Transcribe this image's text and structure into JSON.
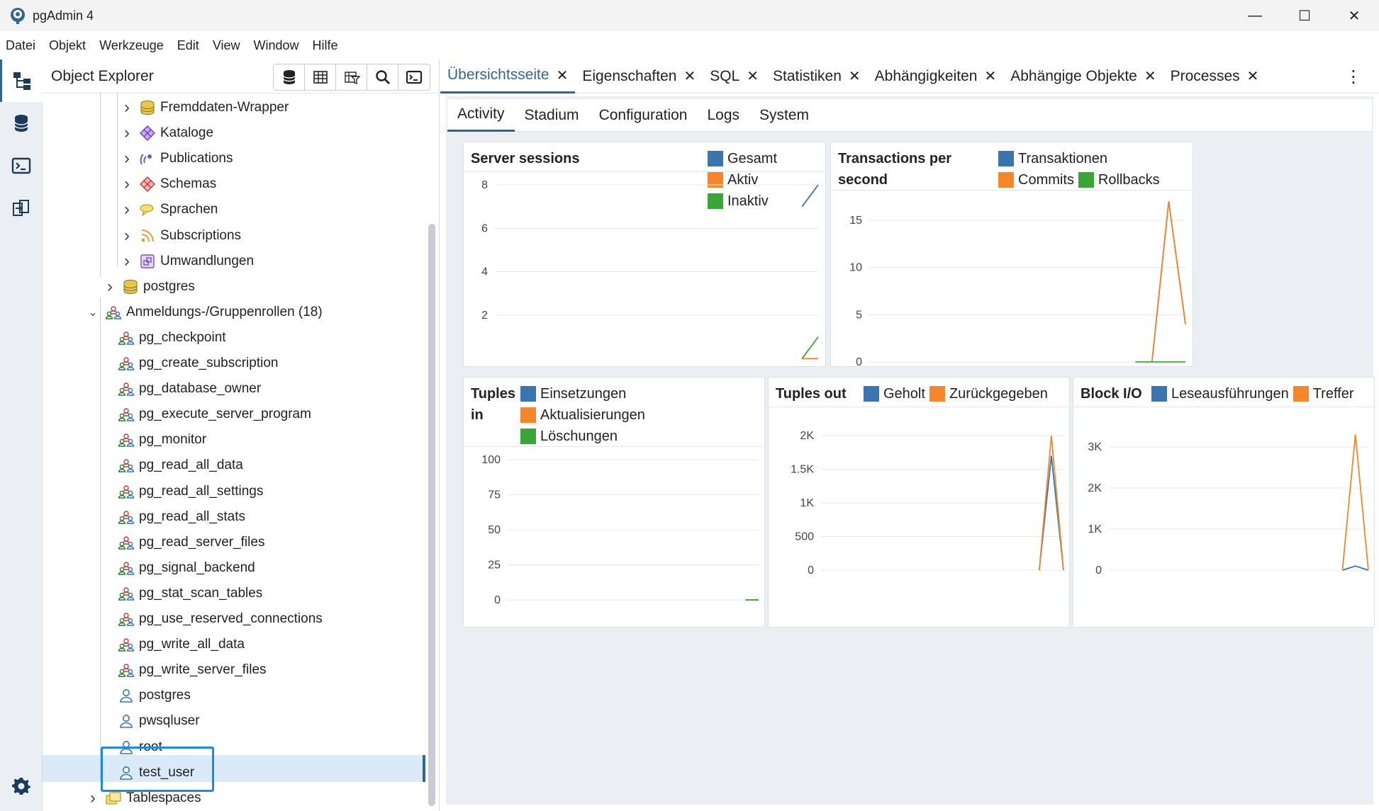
{
  "window": {
    "title": "pgAdmin 4",
    "minimize": "—",
    "maximize": "☐",
    "close": "✕"
  },
  "menu": [
    "Datei",
    "Objekt",
    "Werkzeuge",
    "Edit",
    "View",
    "Window",
    "Hilfe"
  ],
  "explorer": {
    "title": "Object Explorer",
    "tools": [
      "database-icon",
      "table-icon",
      "filter-icon",
      "search-icon",
      "terminal-icon"
    ],
    "tree": [
      {
        "label": "Fremddaten-Wrapper",
        "icon": "foreign-data-wrapper-icon",
        "chevron": "›"
      },
      {
        "label": "Kataloge",
        "icon": "catalog-icon",
        "chevron": "›"
      },
      {
        "label": "Publications",
        "icon": "publication-icon",
        "chevron": "›"
      },
      {
        "label": "Schemas",
        "icon": "schema-icon",
        "chevron": "›"
      },
      {
        "label": "Sprachen",
        "icon": "language-icon",
        "chevron": "›"
      },
      {
        "label": "Subscriptions",
        "icon": "subscription-icon",
        "chevron": "›"
      },
      {
        "label": "Umwandlungen",
        "icon": "cast-icon",
        "chevron": "›"
      },
      {
        "label": "postgres",
        "icon": "database-icon",
        "chevron": "›"
      },
      {
        "label": "Anmeldungs-/Gruppenrollen (18)",
        "icon": "group-roles-icon",
        "chevron": "⌄"
      },
      {
        "label": "pg_checkpoint",
        "icon": "group-role-icon"
      },
      {
        "label": "pg_create_subscription",
        "icon": "group-role-icon"
      },
      {
        "label": "pg_database_owner",
        "icon": "group-role-icon"
      },
      {
        "label": "pg_execute_server_program",
        "icon": "group-role-icon"
      },
      {
        "label": "pg_monitor",
        "icon": "group-role-icon"
      },
      {
        "label": "pg_read_all_data",
        "icon": "group-role-icon"
      },
      {
        "label": "pg_read_all_settings",
        "icon": "group-role-icon"
      },
      {
        "label": "pg_read_all_stats",
        "icon": "group-role-icon"
      },
      {
        "label": "pg_read_server_files",
        "icon": "group-role-icon"
      },
      {
        "label": "pg_signal_backend",
        "icon": "group-role-icon"
      },
      {
        "label": "pg_stat_scan_tables",
        "icon": "group-role-icon"
      },
      {
        "label": "pg_use_reserved_connections",
        "icon": "group-role-icon"
      },
      {
        "label": "pg_write_all_data",
        "icon": "group-role-icon"
      },
      {
        "label": "pg_write_server_files",
        "icon": "group-role-icon"
      },
      {
        "label": "postgres",
        "icon": "login-role-icon"
      },
      {
        "label": "pwsqluser",
        "icon": "login-role-icon"
      },
      {
        "label": "root",
        "icon": "login-role-icon"
      },
      {
        "label": "test_user",
        "icon": "login-role-icon",
        "selected": true
      },
      {
        "label": "Tablespaces",
        "icon": "tablespace-icon",
        "chevron": "›"
      }
    ]
  },
  "tabs": [
    {
      "label": "Übersichtsseite",
      "active": true
    },
    {
      "label": "Eigenschaften"
    },
    {
      "label": "SQL"
    },
    {
      "label": "Statistiken"
    },
    {
      "label": "Abhängigkeiten"
    },
    {
      "label": "Abhängige Objekte"
    },
    {
      "label": "Processes"
    }
  ],
  "tab_close": "✕",
  "more_menu": "⋮",
  "subtabs": [
    {
      "label": "Activity",
      "active": true
    },
    {
      "label": "Stadium"
    },
    {
      "label": "Configuration"
    },
    {
      "label": "Logs"
    },
    {
      "label": "System"
    }
  ],
  "colors": {
    "blue": "#3a75b0",
    "orange": "#f5862c",
    "green": "#3aa63a",
    "accent": "#326690"
  },
  "chart_data": [
    {
      "type": "line",
      "title": "Server sessions",
      "series": [
        {
          "name": "Gesamt",
          "color": "#3a75b0",
          "values": [
            null,
            null,
            null,
            null,
            null,
            null,
            null,
            null,
            null,
            null,
            null,
            null,
            null,
            null,
            null,
            null,
            null,
            null,
            null,
            7,
            8
          ]
        },
        {
          "name": "Aktiv",
          "color": "#f5862c",
          "values": [
            null,
            null,
            null,
            null,
            null,
            null,
            null,
            null,
            null,
            null,
            null,
            null,
            null,
            null,
            null,
            null,
            null,
            null,
            null,
            0,
            0
          ]
        },
        {
          "name": "Inaktiv",
          "color": "#3aa63a",
          "values": [
            null,
            null,
            null,
            null,
            null,
            null,
            null,
            null,
            null,
            null,
            null,
            null,
            null,
            null,
            null,
            null,
            null,
            null,
            null,
            0,
            1
          ]
        }
      ],
      "ylim": [
        0,
        8
      ],
      "yticks": [
        "8",
        "6",
        "4",
        "2"
      ]
    },
    {
      "type": "line",
      "title": "Transactions per second",
      "series": [
        {
          "name": "Transaktionen",
          "color": "#3a75b0",
          "values": [
            null,
            null,
            null,
            null,
            null,
            null,
            null,
            null,
            null,
            null,
            null,
            null,
            null,
            null,
            null,
            null,
            null,
            0,
            17,
            4
          ]
        },
        {
          "name": "Commits",
          "color": "#f5862c",
          "values": [
            null,
            null,
            null,
            null,
            null,
            null,
            null,
            null,
            null,
            null,
            null,
            null,
            null,
            null,
            null,
            null,
            null,
            0,
            17,
            4
          ]
        },
        {
          "name": "Rollbacks",
          "color": "#3aa63a",
          "values": [
            null,
            null,
            null,
            null,
            null,
            null,
            null,
            null,
            null,
            null,
            null,
            null,
            null,
            null,
            null,
            null,
            0,
            0,
            0,
            0
          ]
        }
      ],
      "ylim": [
        0,
        17
      ],
      "yticks": [
        "15",
        "10",
        "5",
        "0"
      ]
    },
    {
      "type": "line",
      "title": "Tuples in",
      "series": [
        {
          "name": "Einsetzungen",
          "color": "#3a75b0",
          "values": [
            null,
            null,
            null,
            null,
            null,
            null,
            null,
            null,
            null,
            null,
            null,
            null,
            null,
            null,
            null,
            null,
            null,
            null,
            0,
            0
          ]
        },
        {
          "name": "Aktualisierungen",
          "color": "#f5862c",
          "values": [
            null,
            null,
            null,
            null,
            null,
            null,
            null,
            null,
            null,
            null,
            null,
            null,
            null,
            null,
            null,
            null,
            null,
            null,
            0,
            0
          ]
        },
        {
          "name": "Löschungen",
          "color": "#3aa63a",
          "values": [
            null,
            null,
            null,
            null,
            null,
            null,
            null,
            null,
            null,
            null,
            null,
            null,
            null,
            null,
            null,
            null,
            null,
            null,
            0,
            0
          ]
        }
      ],
      "ylim": [
        0,
        100
      ],
      "yticks": [
        "100",
        "75",
        "50",
        "25",
        "0"
      ]
    },
    {
      "type": "line",
      "title": "Tuples out",
      "series": [
        {
          "name": "Geholt",
          "color": "#3a75b0",
          "values": [
            null,
            null,
            null,
            null,
            null,
            null,
            null,
            null,
            null,
            null,
            null,
            null,
            null,
            null,
            null,
            null,
            null,
            null,
            0,
            1700,
            0
          ]
        },
        {
          "name": "Zurückgegeben",
          "color": "#f5862c",
          "values": [
            null,
            null,
            null,
            null,
            null,
            null,
            null,
            null,
            null,
            null,
            null,
            null,
            null,
            null,
            null,
            null,
            null,
            null,
            0,
            2000,
            0
          ]
        }
      ],
      "ylim": [
        0,
        2000
      ],
      "yticks": [
        "2K",
        "1.5K",
        "1K",
        "500",
        "0"
      ]
    },
    {
      "type": "line",
      "title": "Block I/O",
      "series": [
        {
          "name": "Leseausführungen",
          "color": "#3a75b0",
          "values": [
            null,
            null,
            null,
            null,
            null,
            null,
            null,
            null,
            null,
            null,
            null,
            null,
            null,
            null,
            null,
            null,
            null,
            null,
            0,
            100,
            0
          ]
        },
        {
          "name": "Treffer",
          "color": "#f5862c",
          "values": [
            null,
            null,
            null,
            null,
            null,
            null,
            null,
            null,
            null,
            null,
            null,
            null,
            null,
            null,
            null,
            null,
            null,
            null,
            0,
            3300,
            0
          ]
        }
      ],
      "ylim": [
        0,
        3300
      ],
      "yticks": [
        "3K",
        "2K",
        "1K",
        "0"
      ]
    }
  ]
}
